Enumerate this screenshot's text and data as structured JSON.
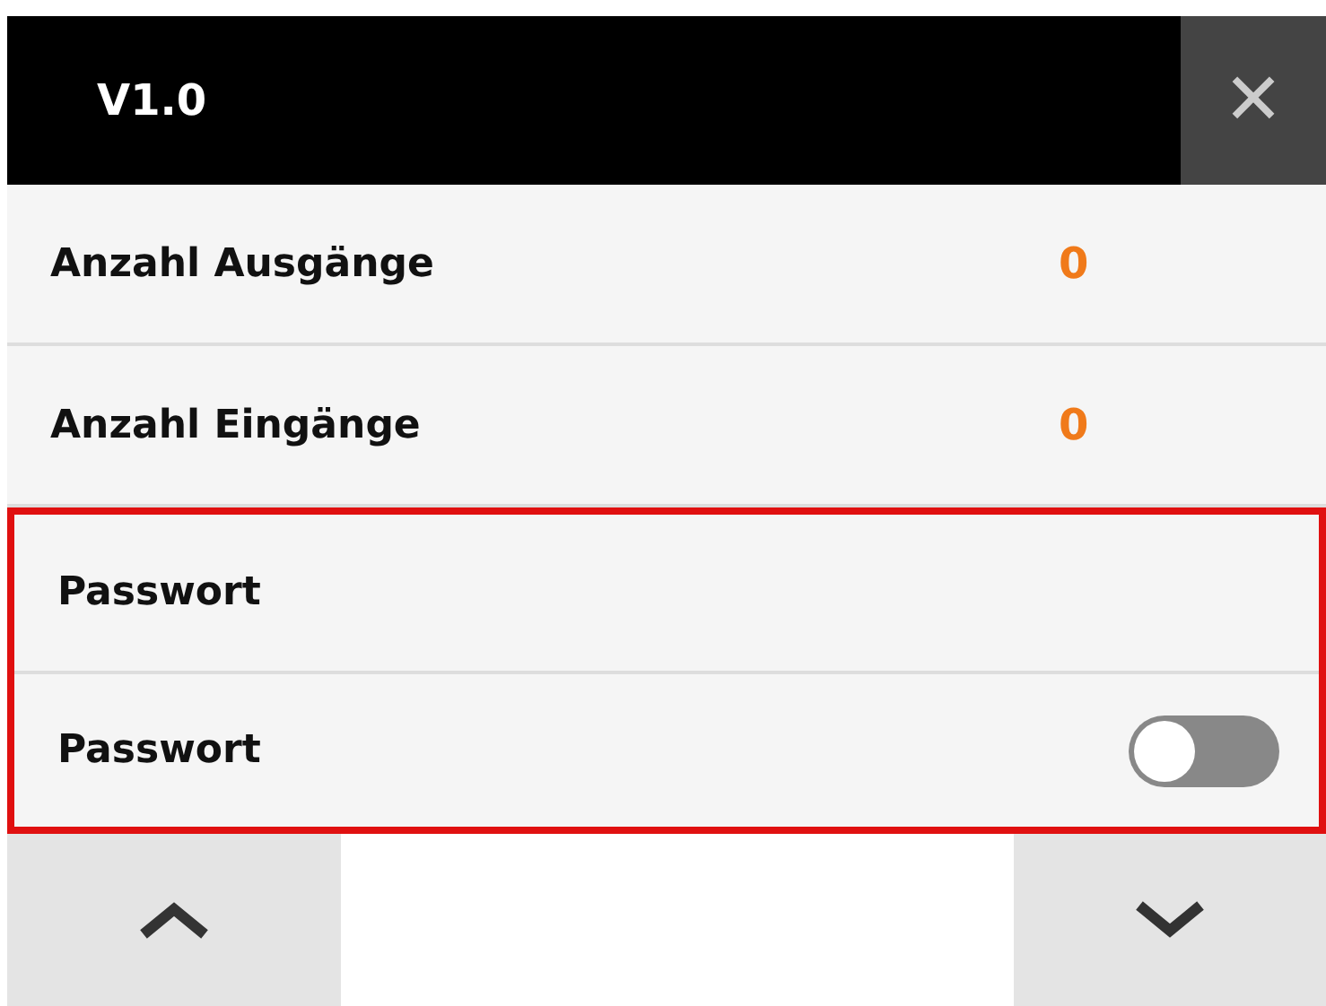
{
  "header": {
    "title": "V1.0",
    "close": "✕"
  },
  "rows": [
    {
      "kind": "value",
      "label": "Anzahl Ausgänge",
      "value": "0"
    },
    {
      "kind": "value",
      "label": "Anzahl Eingänge",
      "value": "0"
    }
  ],
  "highlighted_rows": [
    {
      "kind": "plain",
      "label": "Passwort"
    },
    {
      "kind": "toggle",
      "label": "Passwort",
      "on": false
    }
  ]
}
